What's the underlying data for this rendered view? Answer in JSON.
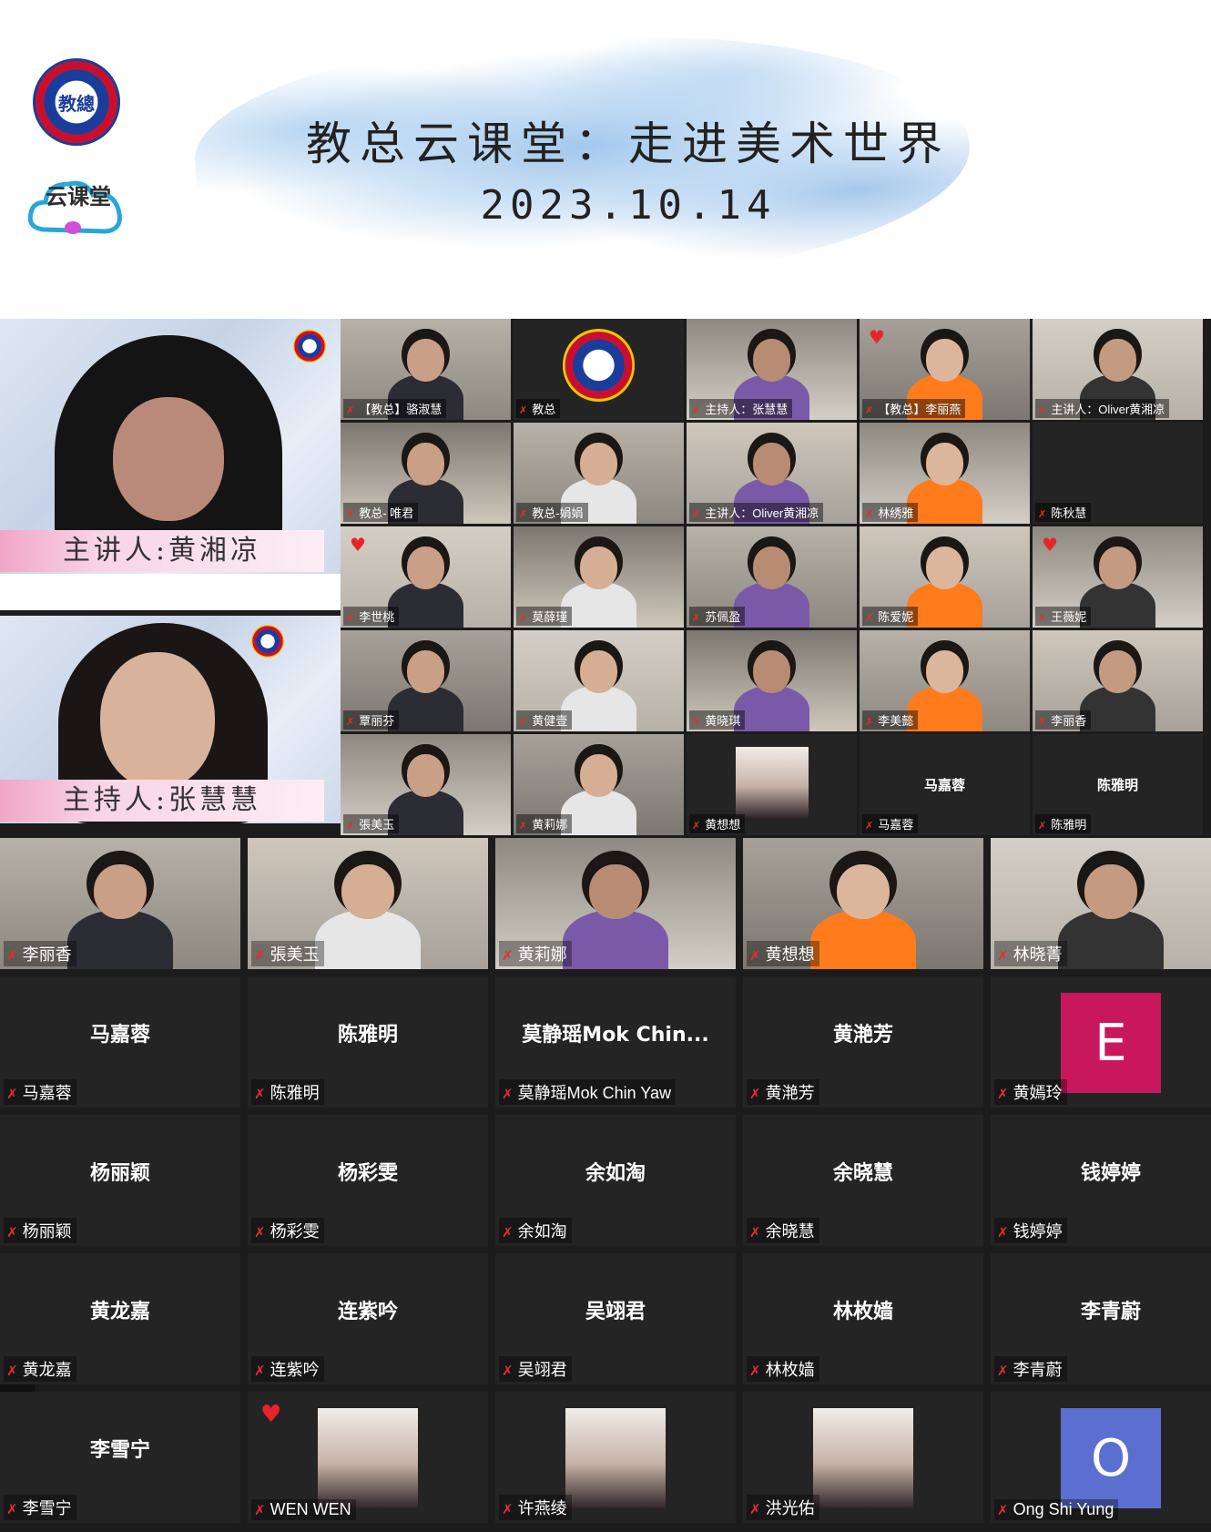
{
  "banner": {
    "title": "教总云课堂：走进美术世界",
    "date": "2023.10.14",
    "logo_text": "教總",
    "cloud_logo_text": "云课堂"
  },
  "hosts": [
    {
      "caption": "主讲人:黄湘凉"
    },
    {
      "caption": "主持人:张慧慧"
    }
  ],
  "small_grid": [
    {
      "name": "【教总】骆淑慧",
      "kind": "video"
    },
    {
      "name": "教总",
      "kind": "logo"
    },
    {
      "name": "主持人：张慧慧",
      "kind": "video",
      "active": true
    },
    {
      "name": "【教总】李丽燕",
      "kind": "video",
      "heart": true
    },
    {
      "name": "主讲人：Oliver黄湘凉",
      "kind": "video"
    },
    {
      "name": "教总- 唯君",
      "kind": "video"
    },
    {
      "name": "教总-娟娟",
      "kind": "video"
    },
    {
      "name": "主讲人：Oliver黄湘凉",
      "kind": "video"
    },
    {
      "name": "林绣雅",
      "kind": "video"
    },
    {
      "name": "陈秋慧",
      "kind": "blank"
    },
    {
      "name": "李世桃",
      "kind": "video",
      "heart": true
    },
    {
      "name": "莫薛瑾",
      "kind": "video"
    },
    {
      "name": "苏佩盈",
      "kind": "video"
    },
    {
      "name": "陈爱妮",
      "kind": "video"
    },
    {
      "name": "王薇妮",
      "kind": "video",
      "heart": true
    },
    {
      "name": "覃丽芬",
      "kind": "video"
    },
    {
      "name": "黄健壹",
      "kind": "video"
    },
    {
      "name": "黄晓琪",
      "kind": "video"
    },
    {
      "name": "李美懿",
      "kind": "video"
    },
    {
      "name": "李丽香",
      "kind": "video"
    },
    {
      "name": "張美玉",
      "kind": "video"
    },
    {
      "name": "黄莉娜",
      "kind": "video"
    },
    {
      "name": "黄想想",
      "kind": "photo"
    },
    {
      "name": "马嘉蓉",
      "kind": "text",
      "label": "马嘉蓉"
    },
    {
      "name": "陈雅明",
      "kind": "text",
      "label": "陈雅明"
    }
  ],
  "big_grid": [
    {
      "name": "李丽香",
      "kind": "video"
    },
    {
      "name": "張美玉",
      "kind": "video"
    },
    {
      "name": "黄莉娜",
      "kind": "video"
    },
    {
      "name": "黄想想",
      "kind": "video"
    },
    {
      "name": "林晓菁",
      "kind": "video"
    },
    {
      "name": "马嘉蓉",
      "kind": "text",
      "label": "马嘉蓉"
    },
    {
      "name": "陈雅明",
      "kind": "text",
      "label": "陈雅明"
    },
    {
      "name": "莫静瑶Mok Chin Yaw",
      "kind": "text",
      "label": "莫静瑶Mok  Chin..."
    },
    {
      "name": "黄滟芳",
      "kind": "text",
      "label": "黄滟芳"
    },
    {
      "name": "黄嫣玲",
      "kind": "avatar",
      "letter": "E"
    },
    {
      "name": "杨丽颖",
      "kind": "text",
      "label": "杨丽颖"
    },
    {
      "name": "杨彩雯",
      "kind": "text",
      "label": "杨彩雯"
    },
    {
      "name": "余如淘",
      "kind": "text",
      "label": "余如淘"
    },
    {
      "name": "余晓慧",
      "kind": "text",
      "label": "余晓慧"
    },
    {
      "name": "钱婷婷",
      "kind": "text",
      "label": "钱婷婷"
    },
    {
      "name": "黄龙嘉",
      "kind": "text",
      "label": "黄龙嘉"
    },
    {
      "name": "连紫吟",
      "kind": "text",
      "label": "连紫吟"
    },
    {
      "name": "吴翊君",
      "kind": "text",
      "label": "吴翊君"
    },
    {
      "name": "林枚嫱",
      "kind": "text",
      "label": "林枚嫱"
    },
    {
      "name": "李青蔚",
      "kind": "text",
      "label": "李青蔚"
    },
    {
      "name": "李雪宁",
      "kind": "text",
      "label": "李雪宁"
    },
    {
      "name": "WEN WEN",
      "kind": "photo",
      "heart": true
    },
    {
      "name": "许燕绫",
      "kind": "photo"
    },
    {
      "name": "洪光佑",
      "kind": "photo"
    },
    {
      "name": "Ong Shi Yung",
      "kind": "avatar",
      "letter": "O"
    }
  ],
  "pager": {
    "page": "2"
  },
  "colors": {
    "tile_bg": "#242424",
    "gallery_bg": "#1c1c1c",
    "muted_mic": "#e0302e",
    "active_speaker": "#d6e27a",
    "avatar_E": "#c8175d",
    "avatar_O": "#5b6fd1"
  },
  "icons": {
    "mic": "muted-mic-icon",
    "heart": "heart-reaction-icon"
  }
}
